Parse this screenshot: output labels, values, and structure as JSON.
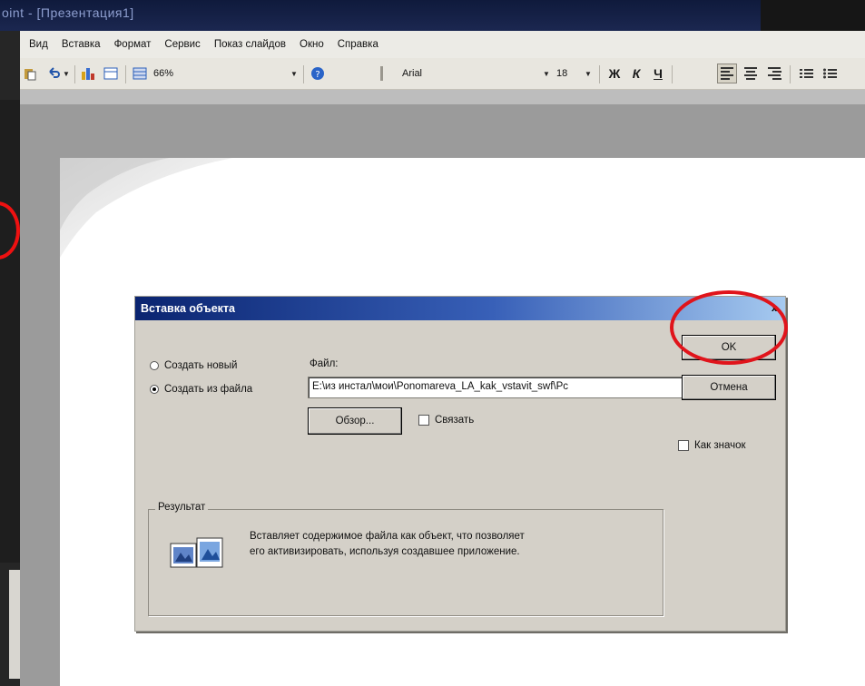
{
  "window": {
    "title": "oint - [Презентация1]"
  },
  "menu": {
    "items": [
      "Вид",
      "Вставка",
      "Формат",
      "Сервис",
      "Показ слайдов",
      "Окно",
      "Справка"
    ]
  },
  "toolbar": {
    "zoom": "66%",
    "font_name": "Arial",
    "font_size": "18",
    "bold_label": "Ж",
    "italic_label": "К",
    "underline_label": "Ч"
  },
  "dialog": {
    "title": "Вставка объекта",
    "close_label": "x",
    "radio_new": "Создать новый",
    "radio_from_file": "Создать из файла",
    "file_label": "Файл:",
    "file_value": "E:\\из инстал\\мои\\Ponomareva_LA_kak_vstavit_swf\\Pc",
    "browse_label": "Обзор...",
    "link_label": "Связать",
    "ok_label": "OK",
    "cancel_label": "Отмена",
    "as_icon_label": "Как значок",
    "result_legend": "Результат",
    "result_line1": "Вставляет содержимое файла как объект, что позволяет",
    "result_line2": "его активизировать, используя создавшее приложение."
  }
}
